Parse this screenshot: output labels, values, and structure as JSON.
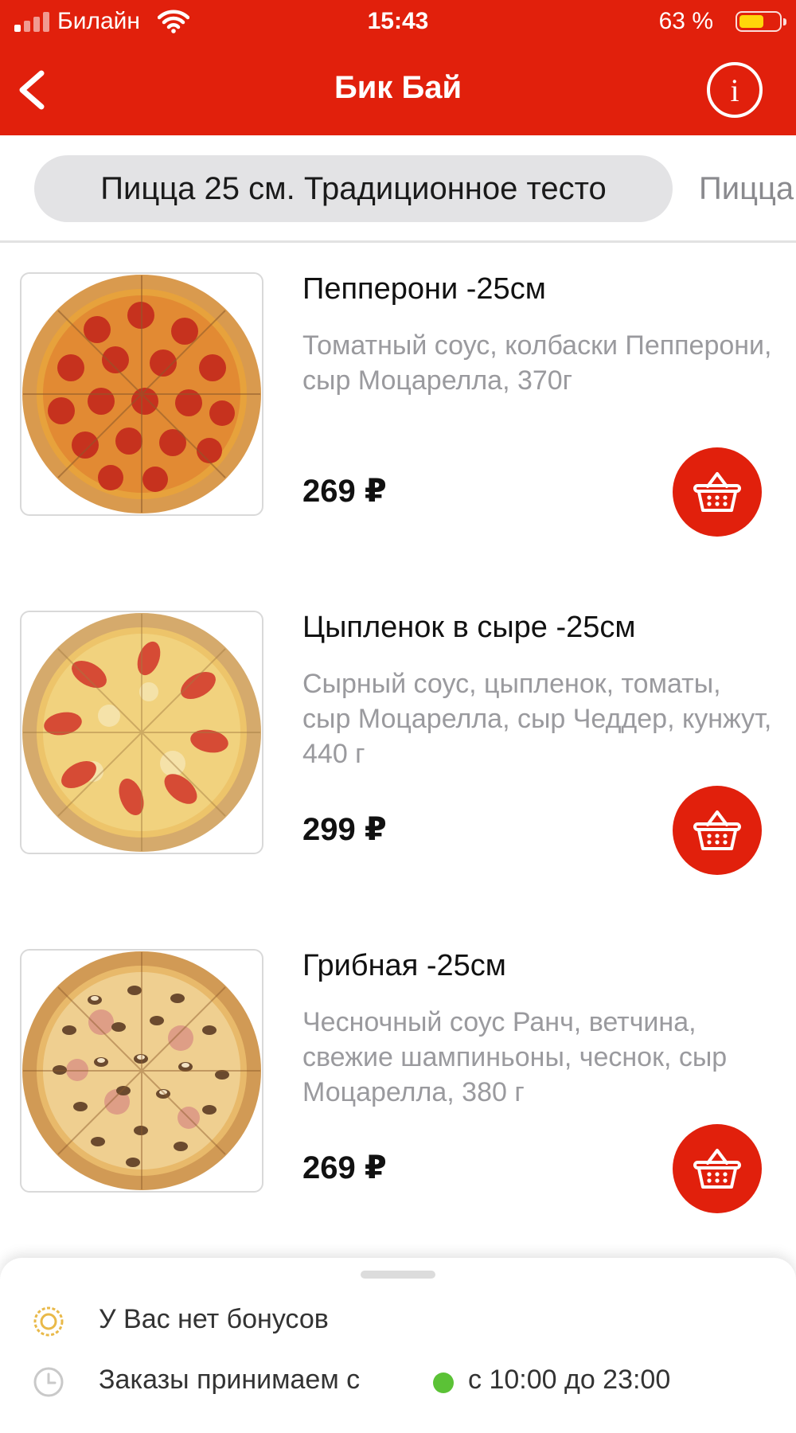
{
  "status_bar": {
    "carrier": "Билайн",
    "time": "15:43",
    "battery_percent": "63 %",
    "battery_level": 0.63,
    "signal_bars": 4,
    "signal_bars_active": 1,
    "icons": [
      "signal-icon",
      "wifi-icon",
      "battery-icon"
    ]
  },
  "nav": {
    "title": "Бик Бай",
    "back_icon": "chevron-left-icon",
    "info_label": "i"
  },
  "tabs": [
    {
      "label": "Пицца 25 см. Традиционное тесто",
      "active": true
    },
    {
      "label": "Пицца",
      "active": false
    }
  ],
  "products": [
    {
      "name": "Пепперони -25см",
      "description": "Томатный соус, колбаски Пепперони, сыр Моцарелла, 370г",
      "price": "269 ₽",
      "image": "pepperoni-pizza-photo"
    },
    {
      "name": "Цыпленок в сыре -25см",
      "description": "Сырный соус, цыпленок, томаты, сыр Моцарелла, сыр Чеддер, кунжут, 440 г",
      "price": "299 ₽",
      "image": "chicken-cheese-pizza-photo"
    },
    {
      "name": "Грибная -25см",
      "description": "Чесночный соус Ранч, ветчина, свежие шампиньоны, чеснок, сыр Моцарелла, 380 г",
      "price": "269 ₽",
      "image": "mushroom-pizza-photo"
    }
  ],
  "sheet": {
    "bonus_text": "У Вас нет бонусов",
    "orders_text": "Заказы принимаем с",
    "hours": "с 10:00 до 23:00",
    "status_color": "#5BC236"
  },
  "colors": {
    "accent": "#E1200C",
    "muted_text": "#9A9A9E",
    "tab_bg": "#E3E3E5"
  }
}
